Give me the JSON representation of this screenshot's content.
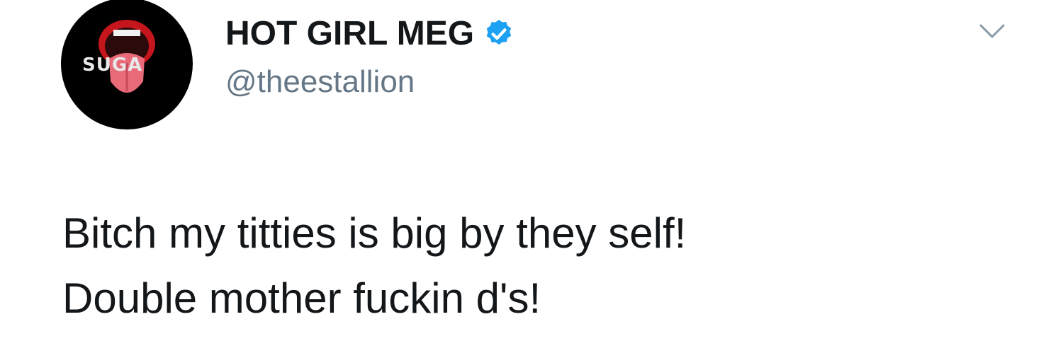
{
  "user": {
    "display_name": "HOT GIRL MEG",
    "handle": "@theestallion",
    "verified": true,
    "avatar_text": "SUGA",
    "avatar_icon": "open-mouth-logo"
  },
  "tweet": {
    "lines": [
      "Bitch my titties is big by they self!",
      "Double mother fuckin d's!"
    ]
  },
  "icons": {
    "verified": "verified-badge-icon",
    "more": "chevron-down-icon"
  },
  "colors": {
    "verified_blue": "#1da1f2",
    "handle_gray": "#657786",
    "text": "#14171a"
  }
}
